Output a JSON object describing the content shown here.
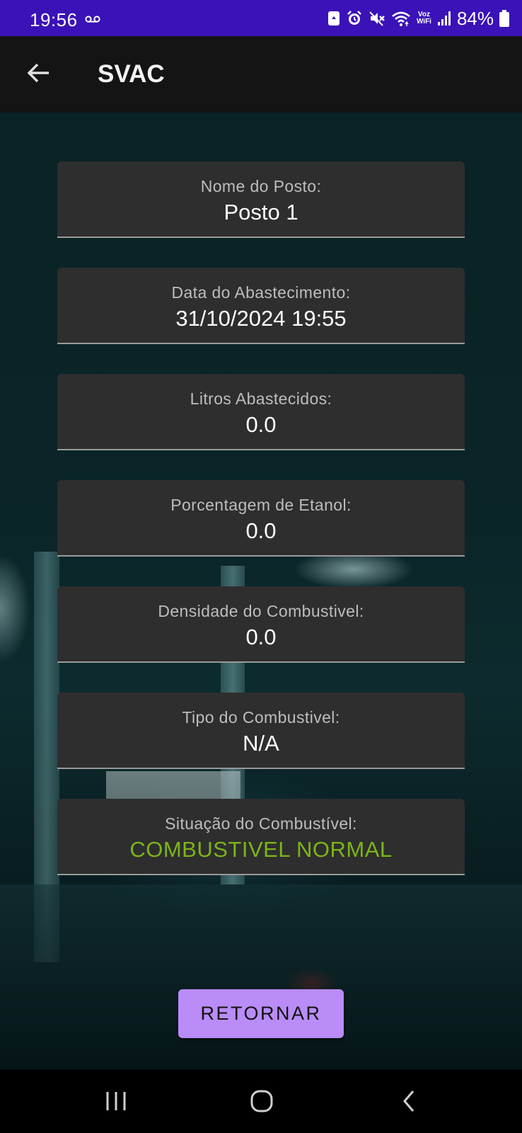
{
  "status_bar": {
    "time": "19:56",
    "battery_percent": "84%",
    "wifi_label_top": "Voz",
    "wifi_label_bottom": "WiFi",
    "icons": [
      "voicemail-icon",
      "screenshot-icon",
      "alarm-icon",
      "mute-icon",
      "wifi-icon",
      "vowifi-icon",
      "signal-icon",
      "battery-icon"
    ]
  },
  "app_bar": {
    "title": "SVAC",
    "back_icon": "arrow-left-icon"
  },
  "fields": [
    {
      "label": "Nome do Posto:",
      "value": "Posto 1"
    },
    {
      "label": "Data do Abastecimento:",
      "value": "31/10/2024 19:55"
    },
    {
      "label": "Litros Abastecidos:",
      "value": "0.0"
    },
    {
      "label": "Porcentagem de Etanol:",
      "value": "0.0"
    },
    {
      "label": "Densidade do Combustivel:",
      "value": "0.0"
    },
    {
      "label": "Tipo do Combustivel:",
      "value": "N/A"
    },
    {
      "label": "Situação do Combustível:",
      "value": "COMBUSTIVEL NORMAL"
    }
  ],
  "colors": {
    "status_bar": "#3a12b8",
    "app_bar": "#141414",
    "card_bg": "#2e2e2e",
    "status_ok": "#7cb518",
    "button": "#b98cf8"
  },
  "actions": {
    "return_label": "RETORNAR"
  },
  "nav_bar": {
    "buttons": [
      "recent-apps-icon",
      "home-icon",
      "back-icon"
    ]
  }
}
